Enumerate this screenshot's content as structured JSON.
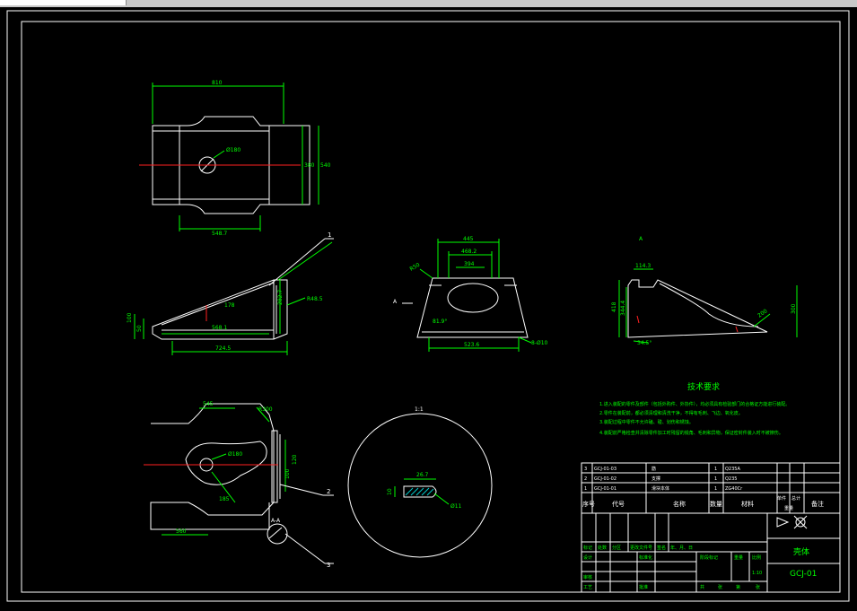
{
  "toolbar": {
    "field_value": ""
  },
  "colors": {
    "background": "#000000",
    "outline": "#ffffff",
    "dimension": "#00ff00",
    "centerline": "#ff2020",
    "hatch": "#00cccc",
    "title_text": "#00ff00"
  },
  "dimensions": {
    "top_width": "810",
    "top_height_inner": "380",
    "top_height_outer": "540",
    "top_bottom": "548.7",
    "top_hole": "Ø180",
    "side_length": "724.5",
    "side_bottom": "568.1",
    "side_a": "282.7",
    "side_r": "R48.5",
    "side_b": "178",
    "side_h1": "100",
    "side_h2": "50",
    "front_top": "445",
    "front_inner1": "468.2",
    "front_inner2": "394",
    "front_bottom": "523.6",
    "front_angle": "81.9°",
    "front_holes": "8-Ø10",
    "front_r": "R50",
    "right_top": "114.3",
    "right_h1": "418",
    "right_h2": "344.4",
    "right_h3": "300",
    "right_angle": "34.5°",
    "right_len": "200",
    "bottom_top": "545",
    "bottom_hole": "Ø180",
    "bottom_r": "R300",
    "bottom_len": "560",
    "bottom_dim1": "185",
    "bottom_dim2": "100",
    "bottom_dim3": "120",
    "detail_w": "26.7",
    "detail_h": "10",
    "detail_hole": "Ø11"
  },
  "labels": {
    "view_a_arrow": "A",
    "view_a_title": "A",
    "section_title": "A-A",
    "detail_scale": "1:1",
    "balloon_1": "1",
    "balloon_2": "2",
    "balloon_3": "3"
  },
  "tech_requirements": {
    "title": "技术要求",
    "items": [
      "1.进入装配的零件及部件（包括外购件、外协件），均必须具有检验部门的合格证方能进行装配。",
      "2.零件在装配前，都必须清理和清洗干净，不得有毛刺、飞边、氧化皮。",
      "3.装配过程中零件不允许磕、碰、划伤和锈蚀。",
      "4.装配前严格检查并清除零件加工时残留的锐角、毛刺和异物，保证密封件装入时不被擦伤。"
    ]
  },
  "bom": {
    "rows": [
      {
        "no": "3",
        "code": "GCJ-01-03",
        "name": "筋",
        "qty": "1",
        "material": "Q235A"
      },
      {
        "no": "2",
        "code": "GCJ-01-02",
        "name": "支撑",
        "qty": "1",
        "material": "Q235"
      },
      {
        "no": "1",
        "code": "GCJ-01-01",
        "name": "滑块本体",
        "qty": "1",
        "material": "ZG40Cr"
      }
    ],
    "header": {
      "no": "序号",
      "code": "代号",
      "name": "名称",
      "qty": "数量",
      "material": "材料",
      "single": "单件",
      "total": "总计",
      "weight": "重量",
      "remark": "备注"
    }
  },
  "title_block": {
    "part_name": "壳体",
    "drawing_no": "GCJ-01",
    "scale": "1:10",
    "row_labels": [
      "标记",
      "处数",
      "分区",
      "更改文件号",
      "签名",
      "年、月、日"
    ],
    "designer": "设计",
    "standard": "标准化",
    "checker": "审核",
    "process": "工艺",
    "approve": "批准",
    "stage": "阶段标记",
    "weight": "重量",
    "scale_label": "比例",
    "sheets": "共",
    "sheet": "张",
    "of": "第",
    "sheet2": "张"
  }
}
